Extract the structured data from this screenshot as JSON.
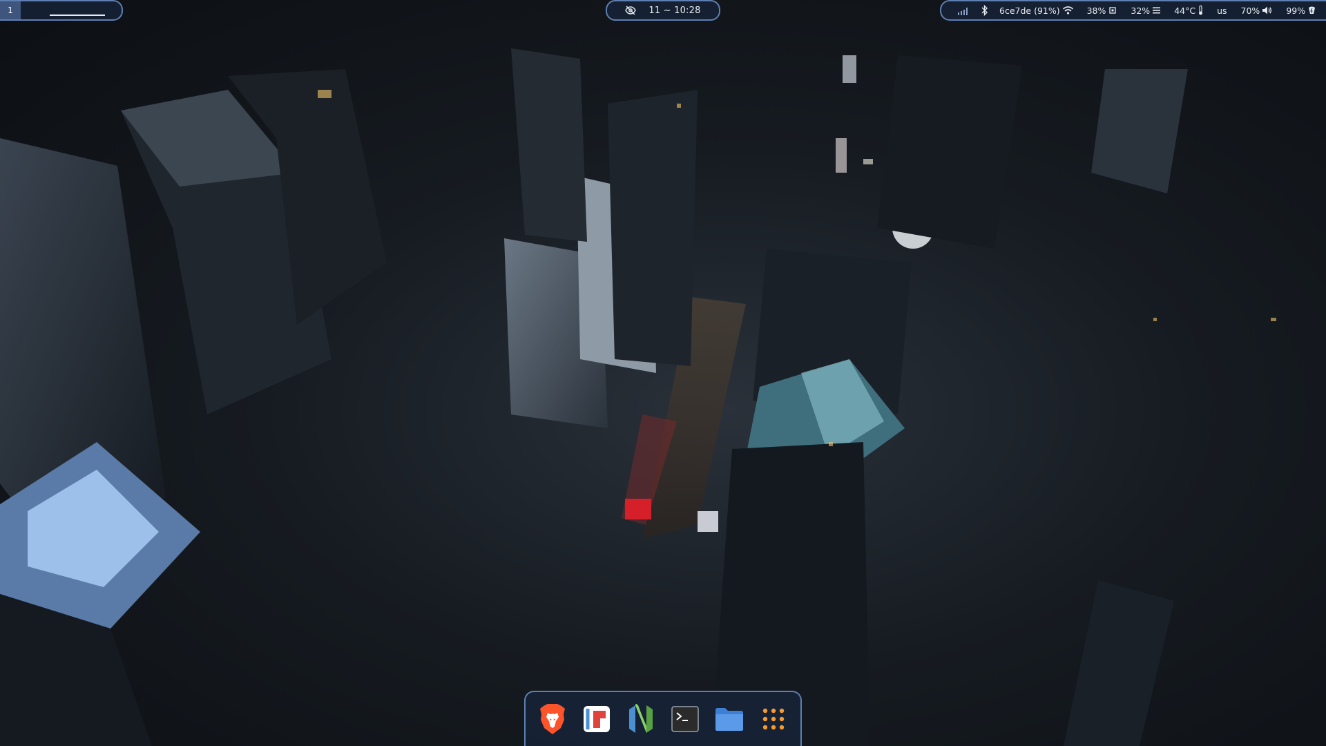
{
  "panel": {
    "workspace": {
      "active": "1"
    },
    "clock": {
      "text": "11 ~ 10:28",
      "icon": "eye-off-icon"
    },
    "tray": {
      "network": "6ce7de (91%)",
      "cpu": "38%",
      "memory": "32%",
      "temperature": "44°C",
      "keyboard_layout": "us",
      "volume": "70%",
      "battery": "99%"
    }
  },
  "dock": {
    "apps": [
      {
        "icon": "brave-browser-icon"
      },
      {
        "icon": "flathub-store-icon"
      },
      {
        "icon": "neovim-icon"
      },
      {
        "icon": "terminal-icon"
      },
      {
        "icon": "file-manager-icon"
      },
      {
        "icon": "app-grid-icon"
      }
    ]
  },
  "colors": {
    "panel_bg": "#162236",
    "panel_border": "#5f7fb3",
    "accent": "#3e557d",
    "brave": "#fb542b",
    "neovim": "#57a143",
    "folder": "#5b9ae8",
    "grid": "#f59a2c"
  }
}
